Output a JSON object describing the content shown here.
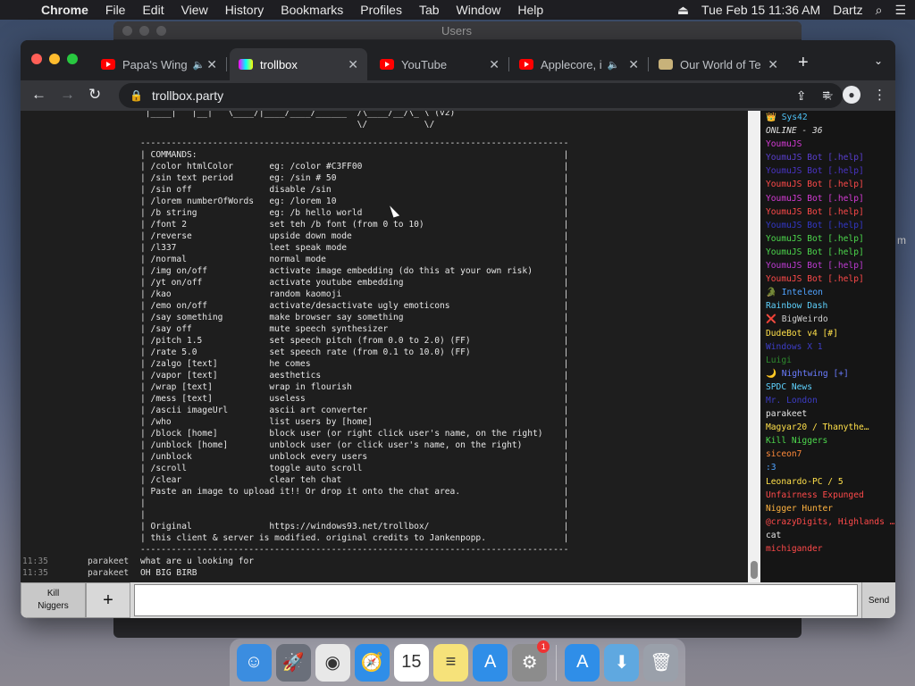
{
  "menubar": {
    "app": "Chrome",
    "items": [
      "File",
      "Edit",
      "View",
      "History",
      "Bookmarks",
      "Profiles",
      "Tab",
      "Window",
      "Help"
    ],
    "datetime": "Tue Feb 15  11:36 AM",
    "user": "Dartz"
  },
  "background_window": {
    "title": "Users"
  },
  "tabs": [
    {
      "label": "Papa's Wing",
      "favicon": "youtube-icon",
      "audio": true
    },
    {
      "label": "trollbox",
      "favicon": "trollbox-icon",
      "audio": false,
      "active": true
    },
    {
      "label": "YouTube",
      "favicon": "youtube-icon",
      "audio": false
    },
    {
      "label": "Applecore, i",
      "favicon": "youtube-icon",
      "audio": true
    },
    {
      "label": "Our World of Te",
      "favicon": "scroll-icon",
      "audio": false
    }
  ],
  "address_bar": {
    "url": "trollbox.party"
  },
  "ascii_art": " |____|   |__|   \\____/|____/____/______  /\\____/__/\\_ \\ (v2)\n                                          \\/           \\/",
  "command_box": "-----------------------------------------------------------------------------------\n| COMMANDS:                                                                       |\n| /color htmlColor       eg: /color #C3FF00                                       |\n| /sin text period       eg: /sin # 50                                            |\n| /sin off               disable /sin                                             |\n| /lorem numberOfWords   eg: /lorem 10                                            |\n| /b string              eg: /b hello world                                       |\n| /font 2                set teh /b font (from 0 to 10)                           |\n| /reverse               upside down mode                                         |\n| /l337                  leet speak mode                                          |\n| /normal                normal mode                                              |\n| /img on/off            activate image embedding (do this at your own risk)      |\n| /yt on/off             activate youtube embedding                               |\n| /kao                   random kaomoji                                           |\n| /emo on/off            activate/desactivate ugly emoticons                      |\n| /say something         make browser say something                               |\n| /say off               mute speech synthesizer                                  |\n| /pitch 1.5             set speech pitch (from 0.0 to 2.0) (FF)                  |\n| /rate 5.0              set speech rate (from 0.1 to 10.0) (FF)                  |\n| /zalgo [text]          he comes                                                 |\n| /vapor [text]          aesthetics                                               |\n| /wrap [text]           wrap in flourish                                         |\n| /mess [text]           useless                                                  |\n| /ascii imageUrl        ascii art converter                                      |\n| /who                   list users by [home]                                     |\n| /block [home]          block user (or right click user's name, on the right)    |\n| /unblock [home]        unblock user (or click user's name, on the right)        |\n| /unblock               unblock every users                                      |\n| /scroll                toggle auto scroll                                       |\n| /clear                 clear teh chat                                           |\n| Paste an image to upload it!! Or drop it onto the chat area.                    |\n|                                                                                 |\n|                                                                                 |\n| Original               https://windows93.net/trollbox/                          |\n| this client & server is modified. original credits to Jankenpopp.               |\n-----------------------------------------------------------------------------------",
  "messages": [
    {
      "time": "11:35",
      "nick": "parakeet",
      "text": "what are u looking for"
    },
    {
      "time": "11:35",
      "nick": "parakeet",
      "text": "OH BIG BIRB"
    }
  ],
  "users_header": "ONLINE - 36",
  "top_user": {
    "name": "Sys42",
    "color": "#4fc3f7"
  },
  "users": [
    {
      "name": "YoumuJS",
      "color": "#d63bd6"
    },
    {
      "name": "YoumuJS Bot [.help]",
      "color": "#5a3fd1"
    },
    {
      "name": "YoumuJS Bot [.help]",
      "color": "#4a34c8"
    },
    {
      "name": "YoumuJS Bot [.help]",
      "color": "#ff4a4a"
    },
    {
      "name": "YoumuJS Bot [.help]",
      "color": "#d63bd6"
    },
    {
      "name": "YoumuJS Bot [.help]",
      "color": "#ff4a4a"
    },
    {
      "name": "YoumuJS Bot [.help]",
      "color": "#3438c9"
    },
    {
      "name": "YoumuJS Bot [.help]",
      "color": "#4dd94d"
    },
    {
      "name": "YoumuJS Bot [.help]",
      "color": "#4dd94d"
    },
    {
      "name": "YoumuJS Bot [.help]",
      "color": "#c03cd6"
    },
    {
      "name": "YoumuJS Bot [.help]",
      "color": "#ff4a4a"
    },
    {
      "name": "🐊 Inteleon",
      "color": "#4fa3ff"
    },
    {
      "name": "Rainbow Dash",
      "color": "#5fd3ff"
    },
    {
      "name": "❌ BigWeirdo",
      "color": "#cfcfcf"
    },
    {
      "name": "DudeBot v4 [#]",
      "color": "#ffe04a"
    },
    {
      "name": "Windows X 1",
      "color": "#3d3dc8"
    },
    {
      "name": "Luigi",
      "color": "#2e8b2e"
    },
    {
      "name": "🌙 Nightwing [+]",
      "color": "#6a7cff"
    },
    {
      "name": "SPDC News",
      "color": "#5fd3ff"
    },
    {
      "name": "Mr. London",
      "color": "#3d3dc8"
    },
    {
      "name": "parakeet",
      "color": "#e6e6e6"
    },
    {
      "name": "Magyar20 / Thanythe…",
      "color": "#ffe04a"
    },
    {
      "name": "Kill Niggers",
      "color": "#4dd94d"
    },
    {
      "name": "siceon7",
      "color": "#ff8a3a"
    },
    {
      "name": ":3",
      "color": "#4fa3ff"
    },
    {
      "name": "Leonardo-PC / 5",
      "color": "#ffe04a"
    },
    {
      "name": "Unfairness Expunged",
      "color": "#ff4a4a"
    },
    {
      "name": "Nigger Hunter",
      "color": "#ffb340"
    },
    {
      "name": "@crazyDigits, Highlands …",
      "color": "#ff4a4a"
    },
    {
      "name": "cat",
      "color": "#e6e6e6"
    },
    {
      "name": "michigander",
      "color": "#ff4a4a"
    }
  ],
  "input_bar": {
    "nick_line1": "Kill",
    "nick_line2": "Niggers",
    "add": "+",
    "send": "Send"
  },
  "dock": {
    "apps": [
      {
        "name": "finder-icon",
        "color": "#3b8de0",
        "glyph": "☺"
      },
      {
        "name": "launchpad-icon",
        "color": "#6a6f7a",
        "glyph": "🚀"
      },
      {
        "name": "chrome-icon",
        "color": "#e8e8e8",
        "glyph": "◉"
      },
      {
        "name": "safari-icon",
        "color": "#2f8ee8",
        "glyph": "🧭"
      },
      {
        "name": "calendar-icon",
        "color": "#ffffff",
        "glyph": "15"
      },
      {
        "name": "notes-icon",
        "color": "#f6e27a",
        "glyph": "≡"
      },
      {
        "name": "app-store-icon",
        "color": "#2f8ee8",
        "glyph": "A"
      },
      {
        "name": "system-preferences-icon",
        "color": "#8c8c8c",
        "glyph": "⚙"
      },
      {
        "name": "app-store-icon",
        "color": "#2f8ee8",
        "glyph": "A"
      },
      {
        "name": "downloads-folder-icon",
        "color": "#5fa8e0",
        "glyph": "⬇"
      },
      {
        "name": "trash-icon",
        "color": "#9aa0aa",
        "glyph": "🗑"
      }
    ],
    "prefs_badge": "1"
  },
  "side_text": "m"
}
